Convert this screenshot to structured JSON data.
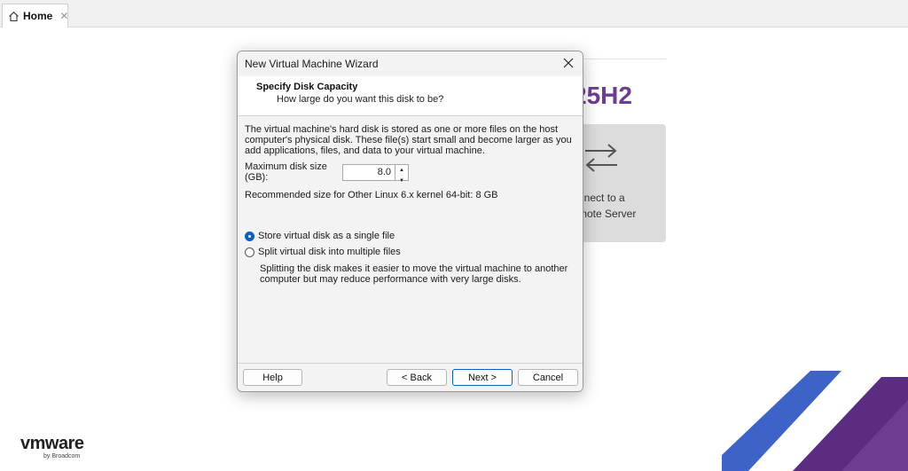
{
  "tabs": [
    {
      "label": "Home"
    }
  ],
  "home": {
    "product_title": "25H2",
    "connect_card": {
      "label": "nnect to a\nmote Server"
    }
  },
  "logo": {
    "brand": "vmware",
    "by": "by Broadcom"
  },
  "dialog": {
    "title": "New Virtual Machine Wizard",
    "header": {
      "title": "Specify Disk Capacity",
      "subtitle": "How large do you want this disk to be?"
    },
    "description": "The virtual machine's hard disk is stored as one or more files on the host computer's physical disk. These file(s) start small and become larger as you add applications, files, and data to your virtual machine.",
    "max_size_label": "Maximum disk size (GB):",
    "max_size_value": "8.0",
    "recommended": "Recommended size for Other Linux 6.x kernel 64-bit: 8 GB",
    "options": {
      "single": {
        "label": "Store virtual disk as a single file",
        "checked": true
      },
      "split": {
        "label": "Split virtual disk into multiple files",
        "checked": false
      }
    },
    "split_note": "Splitting the disk makes it easier to move the virtual machine to another computer but may reduce performance with very large disks.",
    "buttons": {
      "help": "Help",
      "back": "< Back",
      "next": "Next >",
      "cancel": "Cancel"
    }
  },
  "colors": {
    "accent": "#0a5fc4",
    "brand_purple": "#6d3d92",
    "stripe_dark": "#5a2c82",
    "stripe_light": "#3d63c9"
  }
}
